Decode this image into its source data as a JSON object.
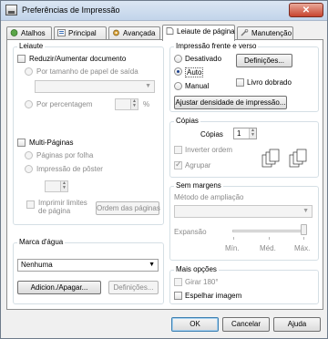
{
  "window": {
    "title": "Preferências de Impressão",
    "close_glyph": "✕"
  },
  "tabs": [
    {
      "label": "Atalhos",
      "icon": "shortcuts-icon"
    },
    {
      "label": "Principal",
      "icon": "main-icon"
    },
    {
      "label": "Avançada",
      "icon": "advanced-icon"
    },
    {
      "label": "Leiaute de página",
      "icon": "page-layout-icon",
      "active": true
    },
    {
      "label": "Manutenção",
      "icon": "maintenance-icon"
    }
  ],
  "layout": {
    "title": "Leiaute",
    "reduce_enlarge": "Reduzir/Aumentar documento",
    "by_paper_size": "Por tamanho de papel de saída",
    "by_percentage": "Por percentagem",
    "percent_unit": "%",
    "multi_page": "Multi-Páginas",
    "pages_per_sheet": "Páginas por folha",
    "poster_print": "Impressão de pôster",
    "print_borders_line1": "Imprimir limites",
    "print_borders_line2": "de página",
    "page_order_button": "Ordem das páginas"
  },
  "watermark": {
    "title": "Marca d'água",
    "selected": "Nenhuma",
    "add_delete_button": "Adicion./Apagar...",
    "settings_button": "Definições..."
  },
  "duplex": {
    "title": "Impressão frente e verso",
    "off": "Desativado",
    "auto": "Auto",
    "manual": "Manual",
    "settings_button": "Definições...",
    "booklet": "Livro dobrado",
    "density_button": "Ajustar densidade de impressão..."
  },
  "copies": {
    "title": "Cópias",
    "copies_label": "Cópias",
    "copies_value": "1",
    "reverse_order": "Inverter ordem",
    "collate": "Agrupar"
  },
  "margins": {
    "title": "Sem margens",
    "method_label": "Método de ampliação",
    "expansion_label": "Expansão",
    "min": "Mín.",
    "mid": "Méd.",
    "max": "Máx."
  },
  "more": {
    "title": "Mais opções",
    "rotate": "Girar 180°",
    "mirror": "Espelhar imagem"
  },
  "footer": {
    "ok": "OK",
    "cancel": "Cancelar",
    "help": "Ajuda"
  },
  "colors": {
    "accent": "#3c7fb1",
    "radio_dot": "#1b3f8c",
    "close": "#c7442f"
  }
}
